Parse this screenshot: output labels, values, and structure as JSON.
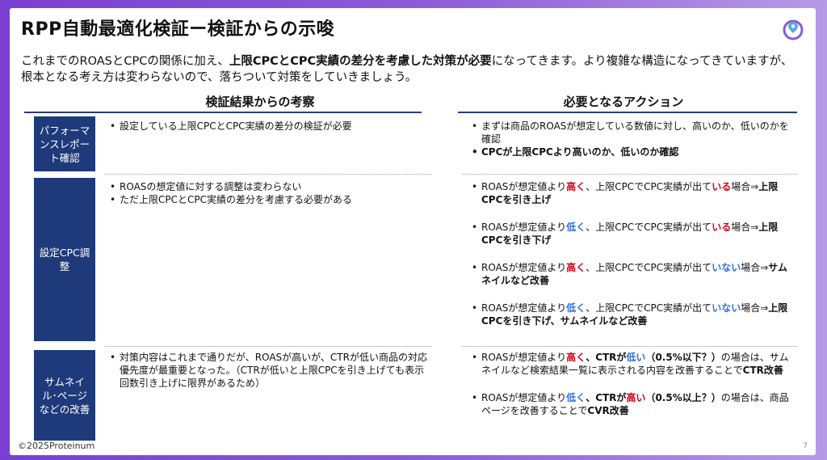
{
  "title": "RPP自動最適化検証ー検証からの示唆",
  "intro": {
    "p1": "これまでのROASとCPCの関係に加え、",
    "p1_bold": "上限CPCとCPC実績の差分を考慮した対策が必要",
    "p2": "になってきます。より複雑な構造になってきていますが、根本となる考え方は変わらないので、落ちついて対策をしていきましょう。"
  },
  "headers": {
    "left": "検証結果からの考察",
    "right": "必要となるアクション"
  },
  "rows": {
    "r1": {
      "label": "パフォーマンスレポート確認",
      "left": [
        "設定している上限CPCとCPC実績の差分の検証が必要"
      ],
      "right1": "まずは商品のROASが想定している数値に対し、高いのか、低いのかを確認",
      "right2": "CPCが上限CPCより高いのか、低いのか確認"
    },
    "r2": {
      "label": "設定CPC調整",
      "left1": "ROASの想定値に対する調整は変わらない",
      "left2": "ただ上限CPCとCPC実績の差分を考慮する必要がある",
      "a_pre": "ROASが想定値より",
      "a_mid": "、上限CPCでCPC実績が出て",
      "a_post": "場合⇒",
      "high": "高く",
      "low": "低く",
      "iru": "いる",
      "inai": "いない",
      "act1": "上限CPCを引き上げ",
      "act2": "上限CPCを引き下げ",
      "act3": "サムネイルなど改善",
      "act4": "上限CPCを引き下げ、サムネイルなど改善"
    },
    "r3": {
      "label": "サムネイル･ページなどの改善",
      "left": "対策内容はこれまで通りだが、ROASが高いが、CTRが低い商品の対応優先度が最重要となった。（CTRが低いと上限CPCを引き上げても表示回数引き上げに限界があるため）",
      "b_pre": "ROASが想定値より",
      "high": "高く",
      "low": "低く",
      "ctr": "、CTRが",
      "ctr_low": "低い",
      "ctr_high": "高い",
      "cond1": "（0.5%以下？）",
      "cond2": "（0.5%以上？）",
      "tail1": "の場合は、サムネイルなど検索結果一覧に表示される内容を改善することで",
      "res1": "CTR改善",
      "tail2": "の場合は、商品ページを改善することで",
      "res2": "CVR改善"
    }
  },
  "footer": "©2025Proteinum",
  "page_number": "7",
  "colors": {
    "accent": "#1f3a7a",
    "purple": "#7a3fd1",
    "red": "#d0021b",
    "blue": "#2f6fe0"
  }
}
